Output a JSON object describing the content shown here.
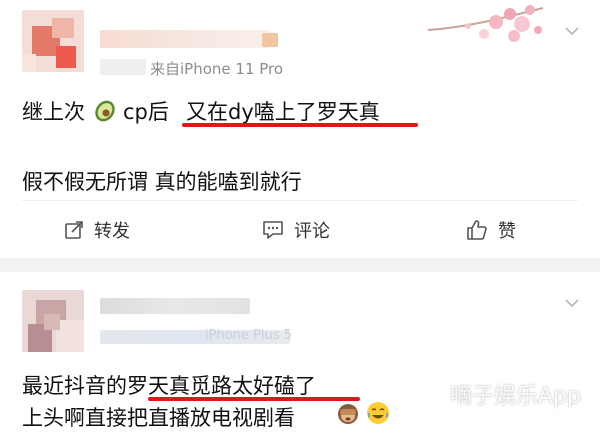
{
  "post1": {
    "source": "来自iPhone 11 Pro",
    "line1_before": "继上次",
    "line1_after": "cp后",
    "line1_highlight": "又在dy嗑上了罗天真",
    "line2": "假不假无所谓 真的能嗑到就行",
    "actions": {
      "repost": "转发",
      "comment": "评论",
      "like": "赞"
    }
  },
  "post2": {
    "source_blurred": "iPhone Plus 5",
    "line1_before": "最近抖音的",
    "line1_highlight": "罗天真觅路太好磕了",
    "line2": "上头啊直接把直播放电视剧看"
  },
  "watermark": "嘀子娱乐App",
  "colors": {
    "accent": "#e01818",
    "divider": "#eeeeee",
    "gap": "#f2f2f2",
    "muted": "#8c8c8c"
  }
}
